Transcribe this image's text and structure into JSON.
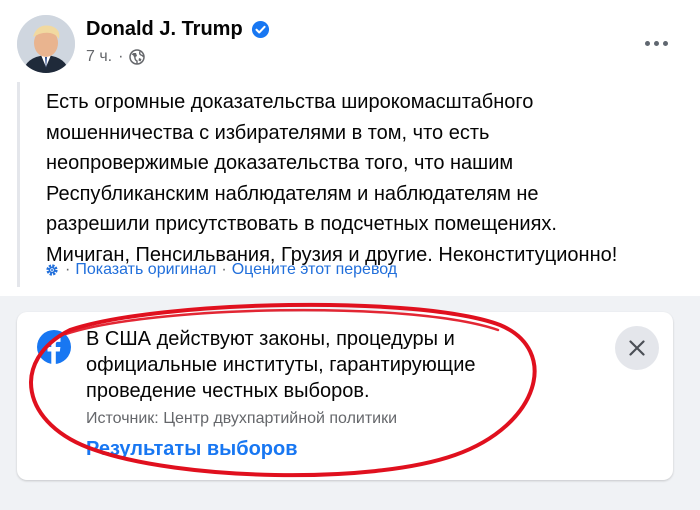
{
  "post": {
    "author": "Donald J. Trump",
    "time": "7 ч.",
    "separator": "·",
    "text": "Есть огромные доказательства широкомасштабного мошенничества с избирателями в том, что есть неопровержимые доказательства того, что нашим Республиканским наблюдателям и наблюдателям не разрешили присутствовать в подсчетных помещениях. Мичиган, Пенсильвания, Грузия и другие. Неконституционно!",
    "translation": {
      "show_original": "Показать оригинал",
      "separator": "·",
      "rate": "Оцените этот перевод"
    }
  },
  "notice": {
    "text": "В США действуют законы, процедуры и официальные институты, гарантирующие проведение честных выборов.",
    "source": "Источник: Центр двухпартийной политики",
    "link": "Результаты выборов"
  },
  "colors": {
    "facebook_blue": "#1877f2",
    "link_blue": "#216fdb",
    "annotation_red": "#e0101e"
  },
  "icons": {
    "verified": "verified-badge-icon",
    "audience": "globe-icon",
    "more": "more-options-icon",
    "translate": "gear-icon",
    "facebook": "facebook-logo-icon",
    "close": "close-icon"
  }
}
